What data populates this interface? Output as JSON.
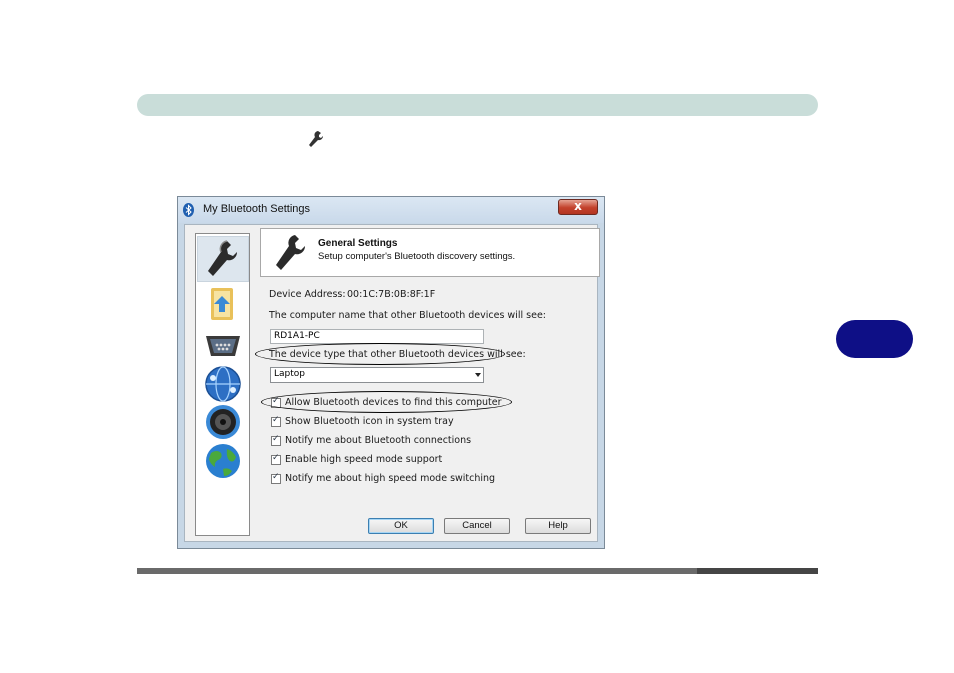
{
  "window": {
    "title": "My Bluetooth Settings",
    "close_label": "x"
  },
  "sidebar": {
    "items": [
      {
        "icon": "wrench-icon",
        "selected": true
      },
      {
        "icon": "folder-icon",
        "selected": false
      },
      {
        "icon": "serial-port-icon",
        "selected": false
      },
      {
        "icon": "network-globe-icon",
        "selected": false
      },
      {
        "icon": "speaker-icon",
        "selected": false
      },
      {
        "icon": "earth-globe-icon",
        "selected": false
      }
    ]
  },
  "header": {
    "title": "General Settings",
    "subtitle": "Setup computer's Bluetooth discovery settings."
  },
  "device": {
    "address_label": "Device Address:",
    "address_value": "00:1C:7B:0B:8F:1F",
    "name_label": "The computer name that other Bluetooth devices will see:",
    "name_value": "RD1A1-PC",
    "type_label": "The device type that other Bluetooth devices will see:",
    "type_value": "Laptop"
  },
  "options": [
    {
      "label": "Allow Bluetooth devices to find this computer",
      "checked": true
    },
    {
      "label": "Show Bluetooth icon in system tray",
      "checked": true
    },
    {
      "label": "Notify me about Bluetooth connections",
      "checked": true
    },
    {
      "label": "Enable high speed mode support",
      "checked": true
    },
    {
      "label": "Notify me about high speed mode switching",
      "checked": true
    }
  ],
  "buttons": {
    "ok": "OK",
    "cancel": "Cancel",
    "help": "Help"
  },
  "colors": {
    "page_band": "#c9ddd9",
    "chapter_tab": "#0e0f86",
    "window_frame": "#c7d7e6",
    "close_button": "#c3412c"
  }
}
